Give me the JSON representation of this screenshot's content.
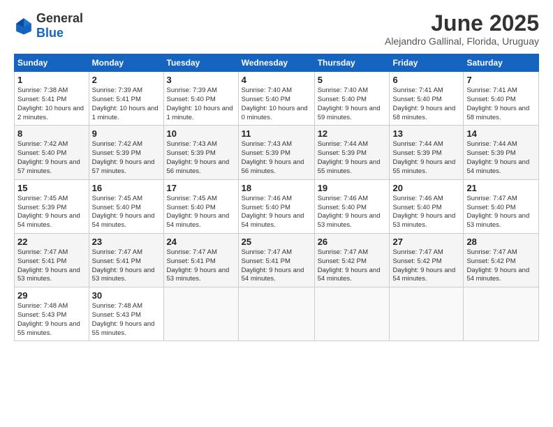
{
  "logo": {
    "general": "General",
    "blue": "Blue"
  },
  "title": {
    "month": "June 2025",
    "location": "Alejandro Gallinal, Florida, Uruguay"
  },
  "headers": [
    "Sunday",
    "Monday",
    "Tuesday",
    "Wednesday",
    "Thursday",
    "Friday",
    "Saturday"
  ],
  "weeks": [
    [
      {
        "day": "1",
        "rise": "7:38 AM",
        "set": "5:41 PM",
        "daylight": "10 hours and 2 minutes."
      },
      {
        "day": "2",
        "rise": "7:39 AM",
        "set": "5:41 PM",
        "daylight": "10 hours and 1 minute."
      },
      {
        "day": "3",
        "rise": "7:39 AM",
        "set": "5:40 PM",
        "daylight": "10 hours and 1 minute."
      },
      {
        "day": "4",
        "rise": "7:40 AM",
        "set": "5:40 PM",
        "daylight": "10 hours and 0 minutes."
      },
      {
        "day": "5",
        "rise": "7:40 AM",
        "set": "5:40 PM",
        "daylight": "9 hours and 59 minutes."
      },
      {
        "day": "6",
        "rise": "7:41 AM",
        "set": "5:40 PM",
        "daylight": "9 hours and 58 minutes."
      },
      {
        "day": "7",
        "rise": "7:41 AM",
        "set": "5:40 PM",
        "daylight": "9 hours and 58 minutes."
      }
    ],
    [
      {
        "day": "8",
        "rise": "7:42 AM",
        "set": "5:40 PM",
        "daylight": "9 hours and 57 minutes."
      },
      {
        "day": "9",
        "rise": "7:42 AM",
        "set": "5:39 PM",
        "daylight": "9 hours and 57 minutes."
      },
      {
        "day": "10",
        "rise": "7:43 AM",
        "set": "5:39 PM",
        "daylight": "9 hours and 56 minutes."
      },
      {
        "day": "11",
        "rise": "7:43 AM",
        "set": "5:39 PM",
        "daylight": "9 hours and 56 minutes."
      },
      {
        "day": "12",
        "rise": "7:44 AM",
        "set": "5:39 PM",
        "daylight": "9 hours and 55 minutes."
      },
      {
        "day": "13",
        "rise": "7:44 AM",
        "set": "5:39 PM",
        "daylight": "9 hours and 55 minutes."
      },
      {
        "day": "14",
        "rise": "7:44 AM",
        "set": "5:39 PM",
        "daylight": "9 hours and 54 minutes."
      }
    ],
    [
      {
        "day": "15",
        "rise": "7:45 AM",
        "set": "5:39 PM",
        "daylight": "9 hours and 54 minutes."
      },
      {
        "day": "16",
        "rise": "7:45 AM",
        "set": "5:40 PM",
        "daylight": "9 hours and 54 minutes."
      },
      {
        "day": "17",
        "rise": "7:45 AM",
        "set": "5:40 PM",
        "daylight": "9 hours and 54 minutes."
      },
      {
        "day": "18",
        "rise": "7:46 AM",
        "set": "5:40 PM",
        "daylight": "9 hours and 54 minutes."
      },
      {
        "day": "19",
        "rise": "7:46 AM",
        "set": "5:40 PM",
        "daylight": "9 hours and 53 minutes."
      },
      {
        "day": "20",
        "rise": "7:46 AM",
        "set": "5:40 PM",
        "daylight": "9 hours and 53 minutes."
      },
      {
        "day": "21",
        "rise": "7:47 AM",
        "set": "5:40 PM",
        "daylight": "9 hours and 53 minutes."
      }
    ],
    [
      {
        "day": "22",
        "rise": "7:47 AM",
        "set": "5:41 PM",
        "daylight": "9 hours and 53 minutes."
      },
      {
        "day": "23",
        "rise": "7:47 AM",
        "set": "5:41 PM",
        "daylight": "9 hours and 53 minutes."
      },
      {
        "day": "24",
        "rise": "7:47 AM",
        "set": "5:41 PM",
        "daylight": "9 hours and 53 minutes."
      },
      {
        "day": "25",
        "rise": "7:47 AM",
        "set": "5:41 PM",
        "daylight": "9 hours and 54 minutes."
      },
      {
        "day": "26",
        "rise": "7:47 AM",
        "set": "5:42 PM",
        "daylight": "9 hours and 54 minutes."
      },
      {
        "day": "27",
        "rise": "7:47 AM",
        "set": "5:42 PM",
        "daylight": "9 hours and 54 minutes."
      },
      {
        "day": "28",
        "rise": "7:47 AM",
        "set": "5:42 PM",
        "daylight": "9 hours and 54 minutes."
      }
    ],
    [
      {
        "day": "29",
        "rise": "7:48 AM",
        "set": "5:43 PM",
        "daylight": "9 hours and 55 minutes."
      },
      {
        "day": "30",
        "rise": "7:48 AM",
        "set": "5:43 PM",
        "daylight": "9 hours and 55 minutes."
      },
      null,
      null,
      null,
      null,
      null
    ]
  ]
}
